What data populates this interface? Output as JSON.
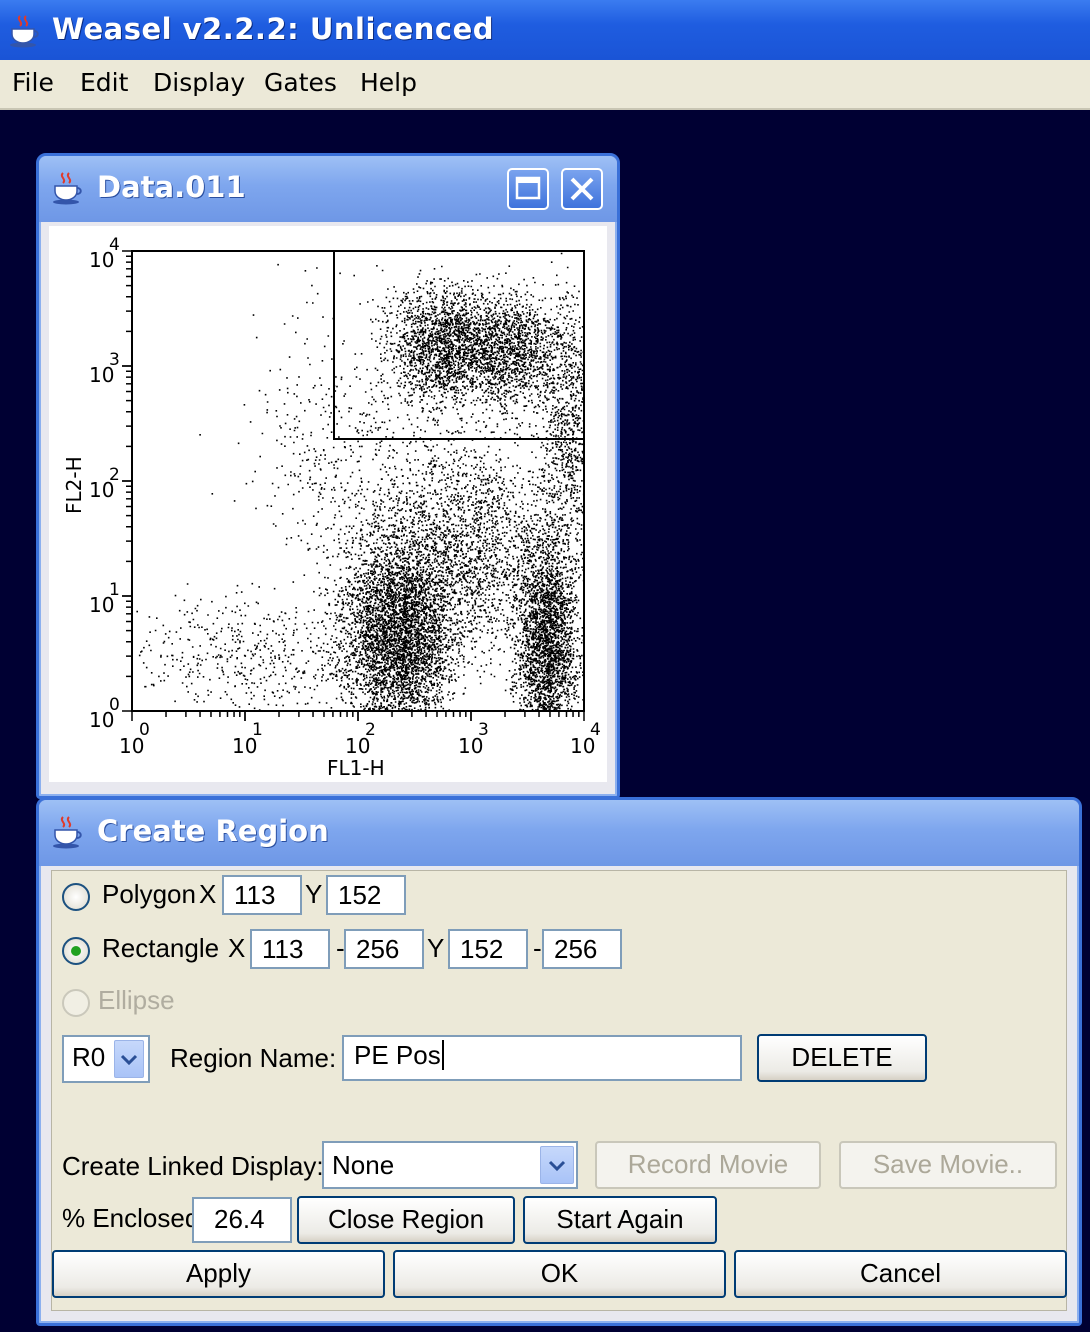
{
  "app": {
    "title": "Weasel v2.2.2: Unlicenced"
  },
  "menu": [
    "File",
    "Edit",
    "Display",
    "Gates",
    "Help"
  ],
  "data_window": {
    "title": "Data.011",
    "plot": {
      "ylabel": "FL2-H",
      "xlabel": "FL1-H",
      "y_ticks": [
        "10",
        "10",
        "10",
        "10",
        "10"
      ],
      "y_exps": [
        "4",
        "3",
        "2",
        "1",
        "0"
      ],
      "x_ticks": [
        "10",
        "10",
        "10",
        "10",
        "10"
      ],
      "x_exps": [
        "0",
        "1",
        "2",
        "3",
        "4"
      ]
    }
  },
  "create_region": {
    "title": "Create Region",
    "polygon": {
      "label": "Polygon",
      "x_label": "X",
      "x": "113",
      "y_label": "Y",
      "y": "152"
    },
    "rectangle": {
      "label": "Rectangle",
      "x_label": "X",
      "x1": "113",
      "dash1": "-",
      "x2": "256",
      "y_label": "Y",
      "y1": "152",
      "dash2": "-",
      "y2": "256"
    },
    "ellipse": {
      "label": "Ellipse"
    },
    "region_select": "R0",
    "region_name_label": "Region Name:",
    "region_name": "PE Pos",
    "delete": "DELETE",
    "linked_label": "Create Linked Display:",
    "linked_value": "None",
    "record_movie": "Record Movie",
    "save_movie": "Save Movie..",
    "enclosed_label": "% Enclosed",
    "enclosed": "26.4",
    "close_region": "Close Region",
    "start_again": "Start Again",
    "apply": "Apply",
    "ok": "OK",
    "cancel": "Cancel"
  }
}
